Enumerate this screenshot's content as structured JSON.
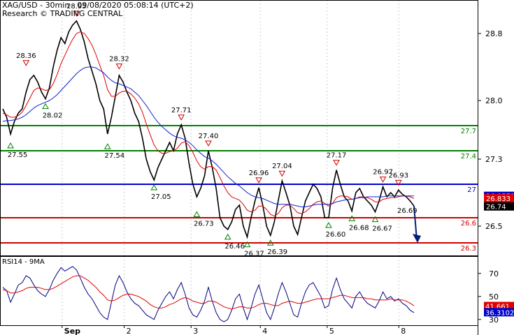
{
  "header": {
    "title": "XAG/USD - 30min - 09/08/2020 05:08:14 (UTC+2)",
    "research": "Research © TRADING CENTRAL"
  },
  "colors": {
    "price": "#000000",
    "ma_fast": "#e00000",
    "ma_slow": "#1020d0",
    "support": "#d00000",
    "resistance": "#008000",
    "pivot": "#0000cc",
    "rsi": "#000080",
    "rsi_ma": "#e00000",
    "grid": "#cccccc",
    "tag_dark": "#000000",
    "tag_red": "#e00000",
    "tag_blue": "#0000cc"
  },
  "chart_data": [
    {
      "type": "line",
      "title": "XAG/USD - 30min",
      "y_ticks": [
        26.5,
        27.3,
        28.0,
        28.8
      ],
      "ylim": [
        26.15,
        29.2
      ],
      "x_ticks": [
        {
          "label": "Sep",
          "pos": 0.13
        },
        {
          "label": "2",
          "pos": 0.26
        },
        {
          "label": "3",
          "pos": 0.4
        },
        {
          "label": "4",
          "pos": 0.545
        },
        {
          "label": "5",
          "pos": 0.685
        },
        {
          "label": "8",
          "pos": 0.835
        }
      ],
      "levels": [
        {
          "value": 27.7,
          "label": "27.7",
          "kind": "resistance"
        },
        {
          "value": 27.4,
          "label": "27.4",
          "kind": "resistance"
        },
        {
          "value": 27.0,
          "label": "27",
          "kind": "pivot"
        },
        {
          "value": 26.6,
          "label": "26.6",
          "kind": "support"
        },
        {
          "value": 26.3,
          "label": "26.3",
          "kind": "support"
        }
      ],
      "price_tags": [
        {
          "value": 26.8571,
          "label": "26.8571",
          "kind": "tag_blue"
        },
        {
          "value": 26.833,
          "label": "26.833",
          "kind": "tag_red"
        },
        {
          "value": 26.74,
          "label": "26.74",
          "kind": "tag_dark"
        }
      ],
      "series": [
        {
          "name": "price",
          "key": "price",
          "values": [
            27.9,
            27.8,
            27.6,
            27.75,
            27.85,
            27.9,
            28.1,
            28.25,
            28.3,
            28.22,
            28.1,
            28.02,
            28.15,
            28.4,
            28.6,
            28.75,
            28.68,
            28.82,
            28.9,
            28.95,
            28.85,
            28.7,
            28.5,
            28.35,
            28.2,
            28.0,
            27.9,
            27.6,
            27.8,
            28.05,
            28.3,
            28.22,
            28.1,
            28.0,
            27.85,
            27.75,
            27.55,
            27.3,
            27.15,
            27.05,
            27.2,
            27.3,
            27.4,
            27.5,
            27.4,
            27.6,
            27.71,
            27.55,
            27.25,
            27.0,
            26.85,
            26.95,
            27.1,
            27.4,
            27.2,
            26.95,
            26.6,
            26.5,
            26.46,
            26.55,
            26.7,
            26.75,
            26.5,
            26.37,
            26.6,
            26.8,
            26.96,
            26.75,
            26.5,
            26.39,
            26.55,
            26.8,
            27.04,
            26.9,
            26.75,
            26.5,
            26.4,
            26.6,
            26.8,
            26.9,
            27.0,
            26.95,
            26.85,
            26.6,
            26.6,
            26.95,
            27.17,
            27.0,
            26.85,
            26.8,
            26.68,
            26.9,
            26.95,
            26.85,
            26.8,
            26.75,
            26.67,
            26.8,
            26.97,
            26.85,
            26.9,
            26.85,
            26.93,
            26.88,
            26.85,
            26.8,
            26.74
          ]
        },
        {
          "name": "ma_fast",
          "key": "ma_fast",
          "values": [
            27.85,
            27.83,
            27.8,
            27.8,
            27.82,
            27.86,
            27.94,
            28.03,
            28.12,
            28.15,
            28.14,
            28.12,
            28.13,
            28.2,
            28.31,
            28.44,
            28.54,
            28.64,
            28.73,
            28.8,
            28.82,
            28.8,
            28.74,
            28.66,
            28.55,
            28.42,
            28.3,
            28.13,
            28.05,
            28.05,
            28.09,
            28.11,
            28.11,
            28.08,
            28.03,
            27.96,
            27.86,
            27.72,
            27.59,
            27.47,
            27.4,
            27.37,
            27.37,
            27.39,
            27.4,
            27.43,
            27.49,
            27.51,
            27.46,
            27.38,
            27.28,
            27.21,
            27.18,
            27.21,
            27.21,
            27.17,
            27.08,
            26.98,
            26.9,
            26.85,
            26.83,
            26.81,
            26.76,
            26.69,
            26.67,
            26.69,
            26.74,
            26.74,
            26.7,
            26.64,
            26.62,
            26.65,
            26.72,
            26.75,
            26.75,
            26.71,
            26.66,
            26.65,
            26.67,
            26.71,
            26.76,
            26.79,
            26.8,
            26.77,
            26.74,
            26.77,
            26.84,
            26.86,
            26.86,
            26.85,
            26.82,
            26.83,
            26.85,
            26.85,
            26.84,
            26.82,
            26.79,
            26.79,
            26.82,
            26.83,
            26.84,
            26.84,
            26.85,
            26.86,
            26.86,
            26.85,
            26.83
          ]
        },
        {
          "name": "ma_slow",
          "key": "ma_slow",
          "values": [
            27.75,
            27.76,
            27.76,
            27.77,
            27.78,
            27.8,
            27.83,
            27.87,
            27.91,
            27.94,
            27.96,
            27.98,
            28.0,
            28.03,
            28.07,
            28.12,
            28.17,
            28.22,
            28.27,
            28.32,
            28.36,
            28.39,
            28.4,
            28.4,
            28.39,
            28.36,
            28.33,
            28.28,
            28.24,
            28.21,
            28.2,
            28.18,
            28.16,
            28.14,
            28.1,
            28.06,
            28.0,
            27.94,
            27.87,
            27.8,
            27.74,
            27.69,
            27.65,
            27.61,
            27.58,
            27.56,
            27.55,
            27.53,
            27.5,
            27.46,
            27.41,
            27.37,
            27.33,
            27.31,
            27.28,
            27.24,
            27.19,
            27.14,
            27.09,
            27.05,
            27.01,
            26.98,
            26.94,
            26.9,
            26.87,
            26.85,
            26.84,
            26.83,
            26.81,
            26.79,
            26.77,
            26.76,
            26.76,
            26.76,
            26.76,
            26.75,
            26.74,
            26.73,
            26.73,
            26.74,
            26.75,
            26.76,
            26.76,
            26.76,
            26.76,
            26.77,
            26.79,
            26.8,
            26.81,
            26.82,
            26.82,
            26.83,
            26.84,
            26.84,
            26.85,
            26.85,
            26.85,
            26.85,
            26.85,
            26.86,
            26.86,
            26.86,
            26.86,
            26.86,
            26.86,
            26.86,
            26.86
          ]
        }
      ],
      "markers": [
        {
          "idx": 2,
          "value": 27.55,
          "label": "27.55",
          "dir": "low"
        },
        {
          "idx": 6,
          "value": 28.36,
          "label": "28.36",
          "dir": "high"
        },
        {
          "idx": 11,
          "value": 28.02,
          "label": "28.02",
          "dir": "low"
        },
        {
          "idx": 19,
          "value": 28.95,
          "label": "28.95",
          "dir": "high"
        },
        {
          "idx": 27,
          "value": 27.54,
          "label": "27.54",
          "dir": "low"
        },
        {
          "idx": 30,
          "value": 28.32,
          "label": "28.32",
          "dir": "high"
        },
        {
          "idx": 39,
          "value": 27.05,
          "label": "27.05",
          "dir": "low"
        },
        {
          "idx": 46,
          "value": 27.71,
          "label": "27.71",
          "dir": "high"
        },
        {
          "idx": 50,
          "value": 26.73,
          "label": "26.73",
          "dir": "low"
        },
        {
          "idx": 53,
          "value": 27.4,
          "label": "27.40",
          "dir": "high"
        },
        {
          "idx": 58,
          "value": 26.46,
          "label": "26.46",
          "dir": "low"
        },
        {
          "idx": 63,
          "value": 26.37,
          "label": "26.37",
          "dir": "low"
        },
        {
          "idx": 66,
          "value": 26.96,
          "label": "26.96",
          "dir": "high"
        },
        {
          "idx": 69,
          "value": 26.39,
          "label": "26.39",
          "dir": "low"
        },
        {
          "idx": 72,
          "value": 27.04,
          "label": "27.04",
          "dir": "high"
        },
        {
          "idx": 84,
          "value": 26.6,
          "label": "26.60",
          "dir": "low"
        },
        {
          "idx": 86,
          "value": 27.17,
          "label": "27.17",
          "dir": "high"
        },
        {
          "idx": 90,
          "value": 26.68,
          "label": "26.68",
          "dir": "low"
        },
        {
          "idx": 96,
          "value": 26.67,
          "label": "26.67",
          "dir": "low"
        },
        {
          "idx": 98,
          "value": 26.97,
          "label": "26.97",
          "dir": "high"
        },
        {
          "idx": 102,
          "value": 26.93,
          "label": "26.93",
          "dir": "high"
        }
      ],
      "forecast": {
        "to_value": 26.3,
        "label": "26.69",
        "label_value": 26.69
      }
    },
    {
      "type": "line",
      "title": "RSI14 - 9MA",
      "y_ticks": [
        30,
        50,
        70
      ],
      "ylim": [
        25,
        85
      ],
      "price_tags": [
        {
          "value": 41.661,
          "label": "41.661",
          "kind": "tag_red"
        },
        {
          "value": 36.3102,
          "label": "36.3102",
          "kind": "tag_blue"
        }
      ],
      "series": [
        {
          "name": "RSI14",
          "key": "rsi",
          "values": [
            58,
            55,
            45,
            52,
            60,
            62,
            68,
            66,
            60,
            55,
            52,
            50,
            56,
            64,
            70,
            75,
            72,
            74,
            76,
            73,
            66,
            58,
            52,
            48,
            42,
            36,
            32,
            30,
            45,
            60,
            68,
            62,
            54,
            48,
            44,
            42,
            38,
            34,
            32,
            30,
            38,
            44,
            50,
            54,
            48,
            56,
            62,
            52,
            40,
            34,
            32,
            38,
            46,
            58,
            46,
            36,
            30,
            28,
            30,
            38,
            48,
            52,
            40,
            30,
            40,
            52,
            60,
            48,
            36,
            30,
            40,
            52,
            62,
            54,
            44,
            34,
            32,
            44,
            54,
            60,
            62,
            56,
            50,
            40,
            42,
            56,
            66,
            56,
            48,
            44,
            40,
            50,
            54,
            48,
            44,
            42,
            40,
            46,
            54,
            48,
            50,
            46,
            48,
            44,
            42,
            38,
            36
          ]
        },
        {
          "name": "9MA",
          "key": "rsi_ma",
          "values": [
            56,
            55,
            53,
            53,
            54,
            55,
            57,
            58,
            58,
            58,
            57,
            56,
            56,
            57,
            59,
            61,
            63,
            65,
            67,
            68,
            68,
            66,
            64,
            61,
            58,
            54,
            51,
            47,
            46,
            47,
            49,
            51,
            52,
            52,
            51,
            50,
            48,
            46,
            43,
            41,
            40,
            40,
            41,
            43,
            44,
            46,
            48,
            49,
            48,
            46,
            45,
            44,
            44,
            46,
            46,
            45,
            43,
            41,
            40,
            39,
            40,
            41,
            41,
            40,
            40,
            41,
            43,
            44,
            44,
            43,
            42,
            42,
            44,
            45,
            46,
            45,
            44,
            44,
            45,
            46,
            47,
            48,
            48,
            48,
            48,
            49,
            50,
            51,
            51,
            50,
            49,
            49,
            49,
            49,
            48,
            48,
            47,
            47,
            47,
            47,
            48,
            47,
            47,
            47,
            46,
            44,
            42
          ]
        }
      ]
    }
  ]
}
